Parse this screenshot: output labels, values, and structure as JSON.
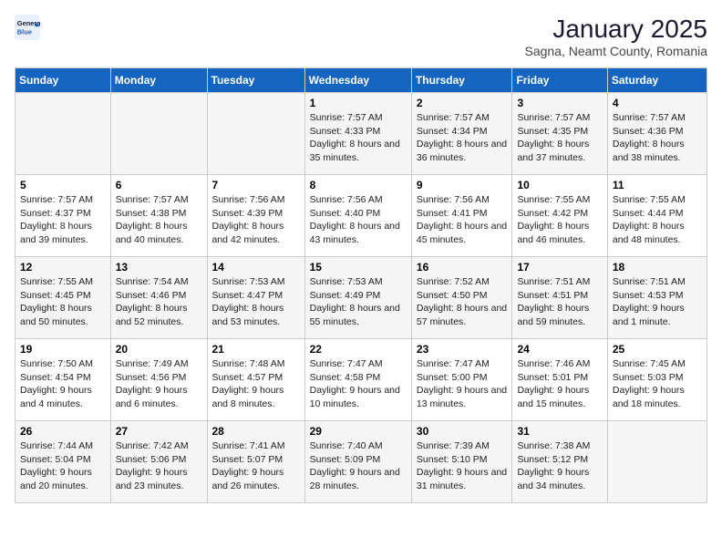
{
  "logo": {
    "general": "General",
    "blue": "Blue"
  },
  "header": {
    "month": "January 2025",
    "location": "Sagna, Neamt County, Romania"
  },
  "weekdays": [
    "Sunday",
    "Monday",
    "Tuesday",
    "Wednesday",
    "Thursday",
    "Friday",
    "Saturday"
  ],
  "weeks": [
    [
      null,
      null,
      null,
      {
        "day": "1",
        "sunrise": "7:57 AM",
        "sunset": "4:33 PM",
        "daylight": "8 hours and 35 minutes."
      },
      {
        "day": "2",
        "sunrise": "7:57 AM",
        "sunset": "4:34 PM",
        "daylight": "8 hours and 36 minutes."
      },
      {
        "day": "3",
        "sunrise": "7:57 AM",
        "sunset": "4:35 PM",
        "daylight": "8 hours and 37 minutes."
      },
      {
        "day": "4",
        "sunrise": "7:57 AM",
        "sunset": "4:36 PM",
        "daylight": "8 hours and 38 minutes."
      }
    ],
    [
      {
        "day": "5",
        "sunrise": "7:57 AM",
        "sunset": "4:37 PM",
        "daylight": "8 hours and 39 minutes."
      },
      {
        "day": "6",
        "sunrise": "7:57 AM",
        "sunset": "4:38 PM",
        "daylight": "8 hours and 40 minutes."
      },
      {
        "day": "7",
        "sunrise": "7:56 AM",
        "sunset": "4:39 PM",
        "daylight": "8 hours and 42 minutes."
      },
      {
        "day": "8",
        "sunrise": "7:56 AM",
        "sunset": "4:40 PM",
        "daylight": "8 hours and 43 minutes."
      },
      {
        "day": "9",
        "sunrise": "7:56 AM",
        "sunset": "4:41 PM",
        "daylight": "8 hours and 45 minutes."
      },
      {
        "day": "10",
        "sunrise": "7:55 AM",
        "sunset": "4:42 PM",
        "daylight": "8 hours and 46 minutes."
      },
      {
        "day": "11",
        "sunrise": "7:55 AM",
        "sunset": "4:44 PM",
        "daylight": "8 hours and 48 minutes."
      }
    ],
    [
      {
        "day": "12",
        "sunrise": "7:55 AM",
        "sunset": "4:45 PM",
        "daylight": "8 hours and 50 minutes."
      },
      {
        "day": "13",
        "sunrise": "7:54 AM",
        "sunset": "4:46 PM",
        "daylight": "8 hours and 52 minutes."
      },
      {
        "day": "14",
        "sunrise": "7:53 AM",
        "sunset": "4:47 PM",
        "daylight": "8 hours and 53 minutes."
      },
      {
        "day": "15",
        "sunrise": "7:53 AM",
        "sunset": "4:49 PM",
        "daylight": "8 hours and 55 minutes."
      },
      {
        "day": "16",
        "sunrise": "7:52 AM",
        "sunset": "4:50 PM",
        "daylight": "8 hours and 57 minutes."
      },
      {
        "day": "17",
        "sunrise": "7:51 AM",
        "sunset": "4:51 PM",
        "daylight": "8 hours and 59 minutes."
      },
      {
        "day": "18",
        "sunrise": "7:51 AM",
        "sunset": "4:53 PM",
        "daylight": "9 hours and 1 minute."
      }
    ],
    [
      {
        "day": "19",
        "sunrise": "7:50 AM",
        "sunset": "4:54 PM",
        "daylight": "9 hours and 4 minutes."
      },
      {
        "day": "20",
        "sunrise": "7:49 AM",
        "sunset": "4:56 PM",
        "daylight": "9 hours and 6 minutes."
      },
      {
        "day": "21",
        "sunrise": "7:48 AM",
        "sunset": "4:57 PM",
        "daylight": "9 hours and 8 minutes."
      },
      {
        "day": "22",
        "sunrise": "7:47 AM",
        "sunset": "4:58 PM",
        "daylight": "9 hours and 10 minutes."
      },
      {
        "day": "23",
        "sunrise": "7:47 AM",
        "sunset": "5:00 PM",
        "daylight": "9 hours and 13 minutes."
      },
      {
        "day": "24",
        "sunrise": "7:46 AM",
        "sunset": "5:01 PM",
        "daylight": "9 hours and 15 minutes."
      },
      {
        "day": "25",
        "sunrise": "7:45 AM",
        "sunset": "5:03 PM",
        "daylight": "9 hours and 18 minutes."
      }
    ],
    [
      {
        "day": "26",
        "sunrise": "7:44 AM",
        "sunset": "5:04 PM",
        "daylight": "9 hours and 20 minutes."
      },
      {
        "day": "27",
        "sunrise": "7:42 AM",
        "sunset": "5:06 PM",
        "daylight": "9 hours and 23 minutes."
      },
      {
        "day": "28",
        "sunrise": "7:41 AM",
        "sunset": "5:07 PM",
        "daylight": "9 hours and 26 minutes."
      },
      {
        "day": "29",
        "sunrise": "7:40 AM",
        "sunset": "5:09 PM",
        "daylight": "9 hours and 28 minutes."
      },
      {
        "day": "30",
        "sunrise": "7:39 AM",
        "sunset": "5:10 PM",
        "daylight": "9 hours and 31 minutes."
      },
      {
        "day": "31",
        "sunrise": "7:38 AM",
        "sunset": "5:12 PM",
        "daylight": "9 hours and 34 minutes."
      },
      null
    ]
  ]
}
